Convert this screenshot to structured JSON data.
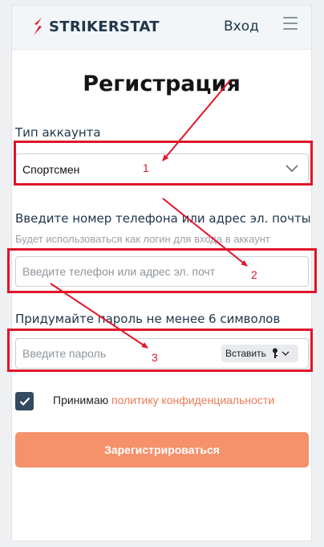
{
  "header": {
    "brand": "STRIKERSTAT",
    "login_label": "Вход"
  },
  "form": {
    "title": "Регистрация",
    "account_type_label": "Тип аккаунта",
    "account_type_value": "Спортсмен",
    "login_label": "Введите номер телефона или адрес эл. почты",
    "login_hint": "Будет использоваться как логин для входа в аккаунт",
    "login_placeholder": "Введите телефон или адрес эл. почты",
    "password_label": "Придумайте пароль не менее 6 символов",
    "password_placeholder": "Введите пароль",
    "paste_label": "Вставить",
    "consent_text": "Принимаю",
    "consent_link": "политику конфиденциальности",
    "consent_checked": true,
    "submit_label": "Зарегистрироваться"
  },
  "annotations": {
    "marker_1": "1",
    "marker_2": "2",
    "marker_3": "3",
    "color": "#e0152a"
  },
  "colors": {
    "brand_dark": "#20364d",
    "accent": "#f5916b",
    "link": "#ec7a55",
    "logo_red": "#e0152a"
  }
}
